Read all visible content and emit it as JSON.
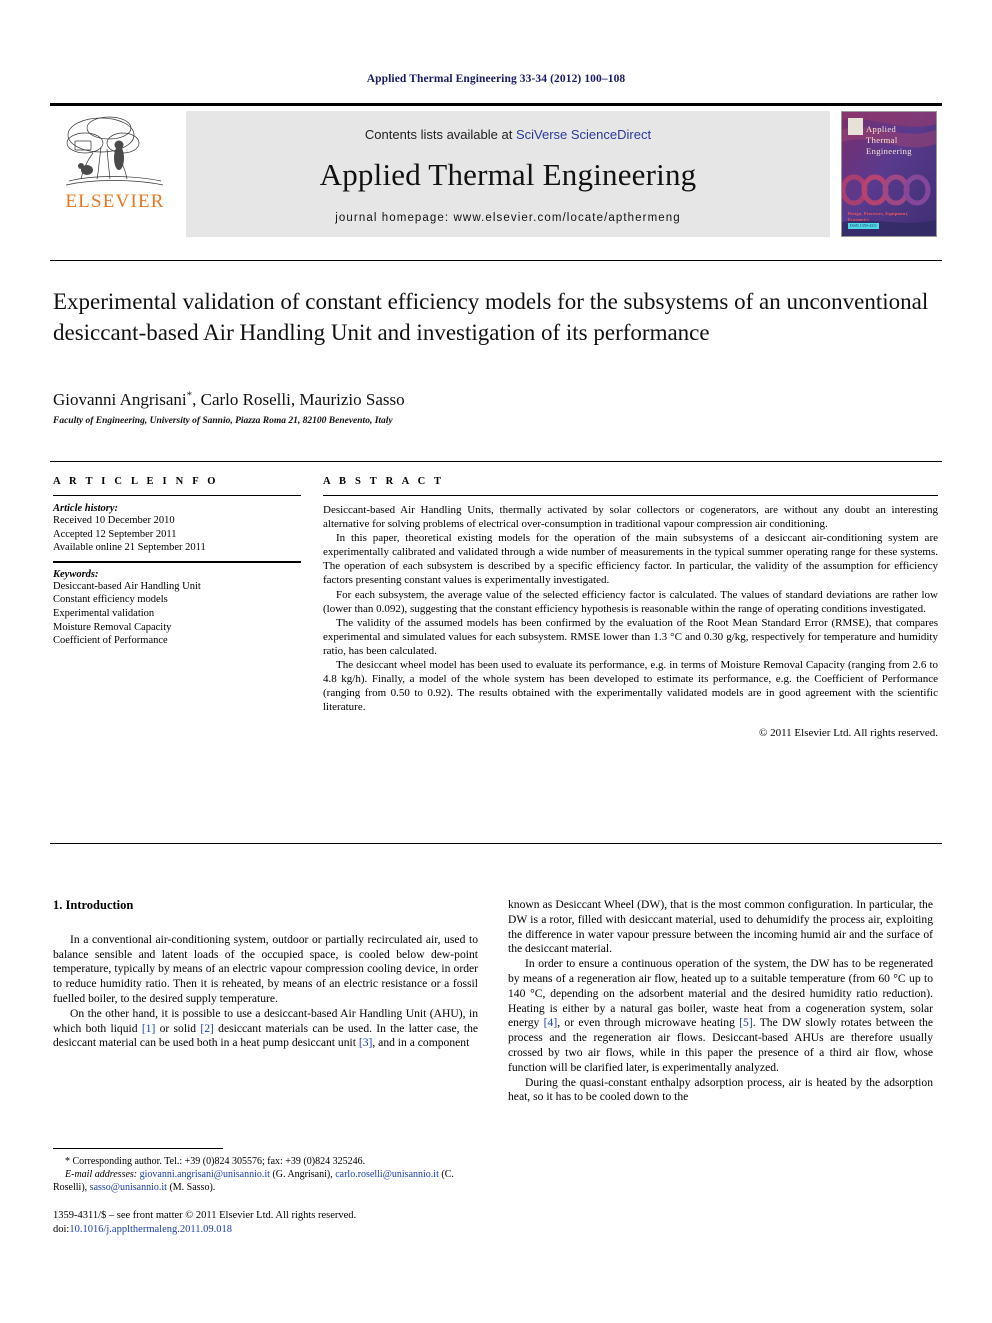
{
  "running_head": "Applied Thermal Engineering 33-34 (2012) 100–108",
  "masthead": {
    "publisher_logo_text": "ELSEVIER",
    "contents_prefix": "Contents lists available at ",
    "contents_link": "SciVerse ScienceDirect",
    "journal_name": "Applied Thermal Engineering",
    "homepage": "journal homepage: www.elsevier.com/locate/apthermeng",
    "cover": {
      "line1": "Applied",
      "line2": "Thermal",
      "line3": "Engineering",
      "footer_authors": "Design, Processes, Equipment, Economics",
      "footer_code": "ISSN 1359-4311"
    }
  },
  "article": {
    "title": "Experimental validation of constant efficiency models for the subsystems of an unconventional desiccant-based Air Handling Unit and investigation of its performance",
    "authors": "Giovanni Angrisani, Carlo Roselli, Maurizio Sasso",
    "affiliation": "Faculty of Engineering, University of Sannio, Piazza Roma 21, 82100 Benevento, Italy"
  },
  "article_info": {
    "heading": "A R T I C L E  I N F O",
    "history_label": "Article history:",
    "history": [
      "Received 10 December 2010",
      "Accepted 12 September 2011",
      "Available online 21 September 2011"
    ],
    "keywords_label": "Keywords:",
    "keywords": [
      "Desiccant-based Air Handling Unit",
      "Constant efficiency models",
      "Experimental validation",
      "Moisture Removal Capacity",
      "Coefficient of Performance"
    ]
  },
  "abstract": {
    "heading": "A B S T R A C T",
    "paragraphs": [
      "Desiccant-based Air Handling Units, thermally activated by solar collectors or cogenerators, are without any doubt an interesting alternative for solving problems of electrical over-consumption in traditional vapour compression air conditioning.",
      "In this paper, theoretical existing models for the operation of the main subsystems of a desiccant air-conditioning system are experimentally calibrated and validated through a wide number of measurements in the typical summer operating range for these systems. The operation of each subsystem is described by a specific efficiency factor. In particular, the validity of the assumption for efficiency factors presenting constant values is experimentally investigated.",
      "For each subsystem, the average value of the selected efficiency factor is calculated. The values of standard deviations are rather low (lower than 0.092), suggesting that the constant efficiency hypothesis is reasonable within the range of operating conditions investigated.",
      "The validity of the assumed models has been confirmed by the evaluation of the Root Mean Standard Error (RMSE), that compares experimental and simulated values for each subsystem. RMSE lower than 1.3 °C and 0.30 g/kg, respectively for temperature and humidity ratio, has been calculated.",
      "The desiccant wheel model has been used to evaluate its performance, e.g. in terms of Moisture Removal Capacity (ranging from 2.6 to 4.8 kg/h). Finally, a model of the whole system has been developed to estimate its performance, e.g. the Coefficient of Performance (ranging from 0.50 to 0.92). The results obtained with the experimentally validated models are in good agreement with the scientific literature."
    ],
    "copyright": "© 2011 Elsevier Ltd. All rights reserved."
  },
  "body": {
    "section_heading": "1. Introduction",
    "left_paragraphs": [
      "In a conventional air-conditioning system, outdoor or partially recirculated air, used to balance sensible and latent loads of the occupied space, is cooled below dew-point temperature, typically by means of an electric vapour compression cooling device, in order to reduce humidity ratio. Then it is reheated, by means of an electric resistance or a fossil fuelled boiler, to the desired supply temperature."
    ],
    "left_paragraph_2_parts": {
      "a": "On the other hand, it is possible to use a desiccant-based Air Handling Unit (AHU), in which both liquid ",
      "r1": "[1]",
      "b": " or solid ",
      "r2": "[2]",
      "c": " desiccant materials can be used. In the latter case, the desiccant material can be used both in a heat pump desiccant unit ",
      "r3": "[3]",
      "d": ", and in a component"
    },
    "right_paragraph_1": "known as Desiccant Wheel (DW), that is the most common configuration. In particular, the DW is a rotor, filled with desiccant material, used to dehumidify the process air, exploiting the difference in water vapour pressure between the incoming humid air and the surface of the desiccant material.",
    "right_paragraph_2_parts": {
      "a": "In order to ensure a continuous operation of the system, the DW has to be regenerated by means of a regeneration air flow, heated up to a suitable temperature (from 60 °C up to 140 °C, depending on the adsorbent material and the desired humidity ratio reduction). Heating is either by a natural gas boiler, waste heat from a cogeneration system, solar energy ",
      "r4": "[4]",
      "b": ", or even through microwave heating ",
      "r5": "[5]",
      "c": ". The DW slowly rotates between the process and the regeneration air flows. Desiccant-based AHUs are therefore usually crossed by two air flows, while in this paper the presence of a third air flow, whose function will be clarified later, is experimentally analyzed."
    },
    "right_paragraph_3": "During the quasi-constant enthalpy adsorption process, air is heated by the adsorption heat, so it has to be cooled down to the"
  },
  "footnote": {
    "corresponding": "* Corresponding author. Tel.: +39 (0)824 305576; fax: +39 (0)824 325246.",
    "email_label": "E-mail addresses:",
    "email1": "giovanni.angrisani@unisannio.it",
    "email1_name": " (G. Angrisani), ",
    "email2": "carlo.roselli@unisannio.it",
    "email2_name": " (C. Roselli), ",
    "email3": "sasso@unisannio.it",
    "email3_name": " (M. Sasso)."
  },
  "issn": {
    "line1": "1359-4311/$ – see front matter © 2011 Elsevier Ltd. All rights reserved.",
    "doi_label": "doi:",
    "doi_value": "10.1016/j.applthermaleng.2011.09.018"
  }
}
